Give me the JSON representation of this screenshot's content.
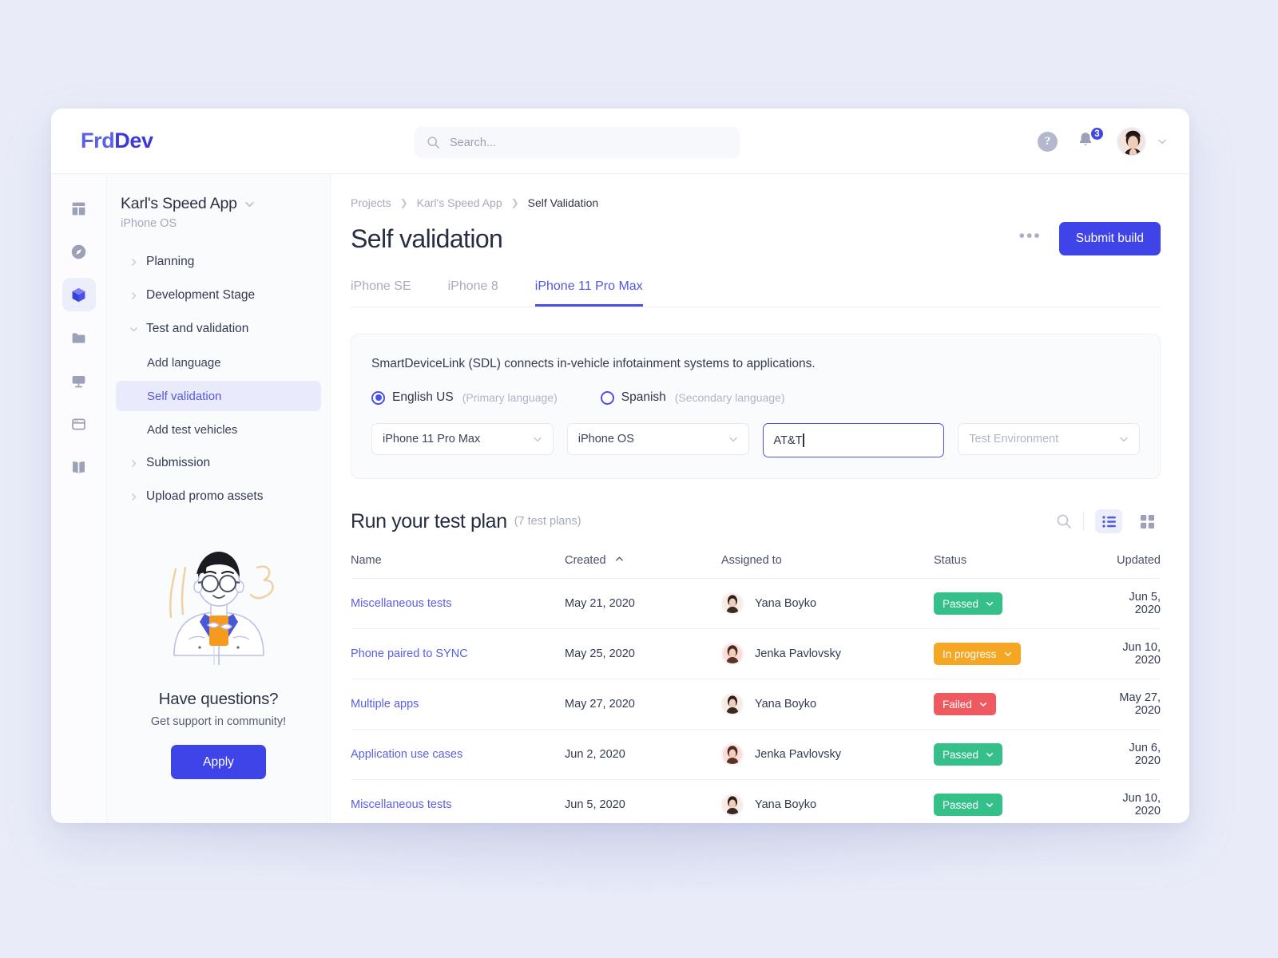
{
  "brand": {
    "part1": "Frd",
    "part2": "Dev",
    "color": "#3f44e8"
  },
  "topbar": {
    "search_placeholder": "Search...",
    "help_label": "?",
    "notification_count": "3"
  },
  "sidebar_rail": [
    {
      "name": "dashboard-icon"
    },
    {
      "name": "compass-icon"
    },
    {
      "name": "cube-icon",
      "active": true
    },
    {
      "name": "folder-icon"
    },
    {
      "name": "monitor-icon"
    },
    {
      "name": "browser-icon"
    },
    {
      "name": "book-icon"
    }
  ],
  "project": {
    "name": "Karl's Speed App",
    "platform": "iPhone OS",
    "nav": [
      {
        "label": "Planning",
        "expanded": false,
        "child": false
      },
      {
        "label": "Development Stage",
        "expanded": false,
        "child": false
      },
      {
        "label": "Test and validation",
        "expanded": true,
        "child": false
      },
      {
        "label": "Add language",
        "child": true,
        "selected": false
      },
      {
        "label": "Self validation",
        "child": true,
        "selected": true
      },
      {
        "label": "Add test vehicles",
        "child": true,
        "selected": false
      },
      {
        "label": "Submission",
        "expanded": false,
        "child": false
      },
      {
        "label": "Upload promo assets",
        "expanded": false,
        "child": false
      }
    ]
  },
  "promo": {
    "title": "Have questions?",
    "subtitle": "Get support in community!",
    "button": "Apply"
  },
  "breadcrumbs": [
    "Projects",
    "Karl's Speed App",
    "Self Validation"
  ],
  "header": {
    "title": "Self validation",
    "kebab": "•••",
    "submit_label": "Submit build"
  },
  "device_tabs": [
    {
      "label": "iPhone SE",
      "active": false
    },
    {
      "label": "iPhone 8",
      "active": false
    },
    {
      "label": "iPhone 11 Pro Max",
      "active": true
    }
  ],
  "config_panel": {
    "description": "SmartDeviceLink (SDL) connects in-vehicle infotainment systems to applications.",
    "languages": [
      {
        "label": "English US",
        "hint": "(Primary language)",
        "checked": true
      },
      {
        "label": "Spanish",
        "hint": "(Secondary language)",
        "checked": false
      }
    ],
    "device_select": "iPhone 11 Pro Max",
    "os_select": "iPhone OS",
    "carrier_input_value": "AT&T",
    "environment_placeholder": "Test Environment"
  },
  "test_plan": {
    "title": "Run your test plan",
    "count": "(7 test plans)",
    "columns": [
      "Name",
      "Created",
      "Assigned to",
      "Status",
      "Updated"
    ],
    "sort_column": "Created",
    "sort_direction": "asc",
    "rows": [
      {
        "name": "Miscellaneous tests",
        "created": "May 21, 2020",
        "assignee": "Yana Boyko",
        "status": "Passed",
        "status_color": "#35c08a",
        "updated": "Jun 5, 2020"
      },
      {
        "name": "Phone paired to SYNC",
        "created": "May 25, 2020",
        "assignee": "Jenka Pavlovsky",
        "status": "In progress",
        "status_color": "#f5a623",
        "updated": "Jun 10, 2020"
      },
      {
        "name": "Multiple apps",
        "created": "May 27, 2020",
        "assignee": "Yana Boyko",
        "status": "Failed",
        "status_color": "#ee5a5f",
        "updated": "May 27, 2020"
      },
      {
        "name": "Application use cases",
        "created": "Jun 2, 2020",
        "assignee": "Jenka Pavlovsky",
        "status": "Passed",
        "status_color": "#35c08a",
        "updated": "Jun 6, 2020"
      },
      {
        "name": "Miscellaneous tests",
        "created": "Jun 5, 2020",
        "assignee": "Yana Boyko",
        "status": "Passed",
        "status_color": "#35c08a",
        "updated": "Jun 10, 2020"
      }
    ]
  }
}
